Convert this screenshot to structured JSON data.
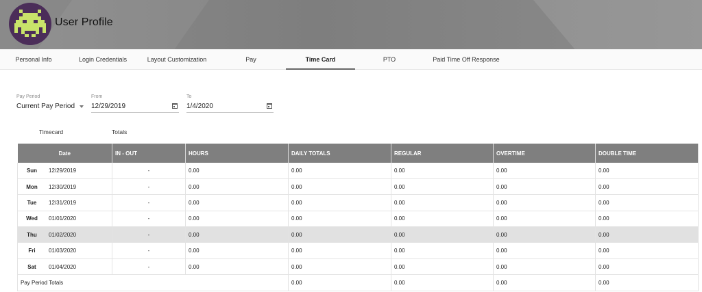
{
  "header": {
    "title": "User Profile"
  },
  "tabs": [
    {
      "label": "Personal Info"
    },
    {
      "label": "Login Credentials"
    },
    {
      "label": "Layout Customization"
    },
    {
      "label": "Pay"
    },
    {
      "label": "Time Card",
      "active": true
    },
    {
      "label": "PTO"
    },
    {
      "label": "Paid Time Off Response"
    }
  ],
  "filters": {
    "pay_period": {
      "label": "Pay Period",
      "value": "Current Pay Period"
    },
    "from": {
      "label": "From",
      "value": "12/29/2019"
    },
    "to": {
      "label": "To",
      "value": "1/4/2020"
    }
  },
  "subtabs": [
    {
      "label": "Timecard"
    },
    {
      "label": "Totals"
    }
  ],
  "table": {
    "columns": [
      "Date",
      "IN - OUT",
      "HOURS",
      "DAILY TOTALS",
      "REGULAR",
      "OVERTIME",
      "DOUBLE TIME"
    ],
    "rows": [
      {
        "day": "Sun",
        "date": "12/29/2019",
        "in_out": "-",
        "hours": "0.00",
        "daily_totals": "0.00",
        "regular": "0.00",
        "overtime": "0.00",
        "double_time": "0.00"
      },
      {
        "day": "Mon",
        "date": "12/30/2019",
        "in_out": "-",
        "hours": "0.00",
        "daily_totals": "0.00",
        "regular": "0.00",
        "overtime": "0.00",
        "double_time": "0.00"
      },
      {
        "day": "Tue",
        "date": "12/31/2019",
        "in_out": "-",
        "hours": "0.00",
        "daily_totals": "0.00",
        "regular": "0.00",
        "overtime": "0.00",
        "double_time": "0.00"
      },
      {
        "day": "Wed",
        "date": "01/01/2020",
        "in_out": "-",
        "hours": "0.00",
        "daily_totals": "0.00",
        "regular": "0.00",
        "overtime": "0.00",
        "double_time": "0.00"
      },
      {
        "day": "Thu",
        "date": "01/02/2020",
        "in_out": "-",
        "hours": "0.00",
        "daily_totals": "0.00",
        "regular": "0.00",
        "overtime": "0.00",
        "double_time": "0.00",
        "highlighted": true
      },
      {
        "day": "Fri",
        "date": "01/03/2020",
        "in_out": "-",
        "hours": "0.00",
        "daily_totals": "0.00",
        "regular": "0.00",
        "overtime": "0.00",
        "double_time": "0.00"
      },
      {
        "day": "Sat",
        "date": "01/04/2020",
        "in_out": "-",
        "hours": "0.00",
        "daily_totals": "0.00",
        "regular": "0.00",
        "overtime": "0.00",
        "double_time": "0.00"
      }
    ],
    "totals": {
      "label": "Pay Period Totals",
      "daily_totals": "0.00",
      "regular": "0.00",
      "overtime": "0.00",
      "double_time": "0.00"
    }
  },
  "colors": {
    "header_bg": "#808080",
    "table_header_bg": "#7f7f7f",
    "avatar_bg": "#4b2d59",
    "avatar_icon": "#c8e36a",
    "highlight_row": "#e1e1e1"
  },
  "icons": {
    "avatar": "space-invader-icon",
    "dropdown": "caret-down-icon",
    "date_picker": "calendar-icon"
  }
}
